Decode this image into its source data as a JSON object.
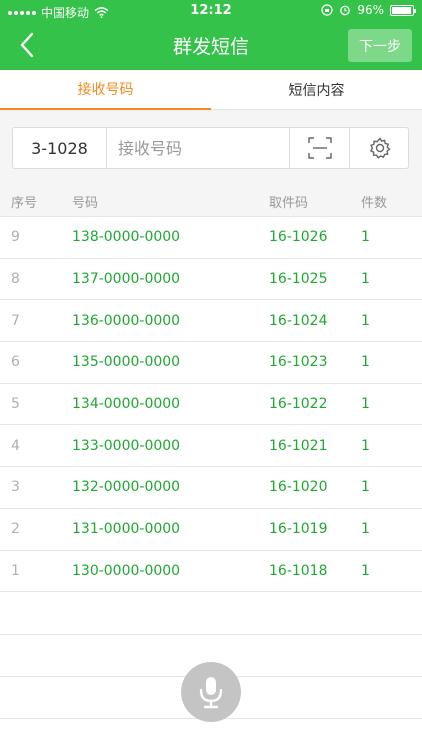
{
  "status_bar": {
    "carrier": "中国移动",
    "time": "12:12",
    "battery": "96%",
    "battery_level": 0.96
  },
  "nav": {
    "title": "群发短信",
    "next_label": "下一步"
  },
  "tabs": [
    {
      "label": "接收号码",
      "active": true
    },
    {
      "label": "短信内容",
      "active": false
    }
  ],
  "input": {
    "prefix": "3-1028",
    "placeholder": "接收号码",
    "value": ""
  },
  "table": {
    "headers": [
      "序号",
      "号码",
      "取件码",
      "件数"
    ],
    "rows": [
      {
        "seq": "9",
        "phone": "138-0000-0000",
        "code": "16-1026",
        "count": "1"
      },
      {
        "seq": "8",
        "phone": "137-0000-0000",
        "code": "16-1025",
        "count": "1"
      },
      {
        "seq": "7",
        "phone": "136-0000-0000",
        "code": "16-1024",
        "count": "1"
      },
      {
        "seq": "6",
        "phone": "135-0000-0000",
        "code": "16-1023",
        "count": "1"
      },
      {
        "seq": "5",
        "phone": "134-0000-0000",
        "code": "16-1022",
        "count": "1"
      },
      {
        "seq": "4",
        "phone": "133-0000-0000",
        "code": "16-1021",
        "count": "1"
      },
      {
        "seq": "3",
        "phone": "132-0000-0000",
        "code": "16-1020",
        "count": "1"
      },
      {
        "seq": "2",
        "phone": "131-0000-0000",
        "code": "16-1019",
        "count": "1"
      },
      {
        "seq": "1",
        "phone": "130-0000-0000",
        "code": "16-1018",
        "count": "1"
      }
    ]
  },
  "icons": {
    "back": "chevron-left-icon",
    "scan": "scan-icon",
    "settings": "gear-icon",
    "mic": "microphone-icon"
  },
  "colors": {
    "brand_green": "#34c24a",
    "next_button": "#7ed889",
    "tab_active": "#f08c1e",
    "row_text": "#1fa832",
    "mic_button": "#c4c4c4"
  }
}
